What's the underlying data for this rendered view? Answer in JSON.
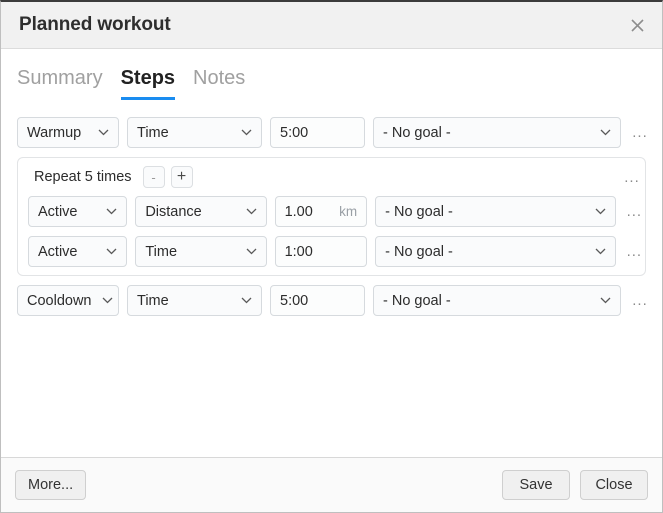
{
  "window": {
    "title": "Planned workout",
    "close_icon": "close-icon"
  },
  "tabs": [
    {
      "label": "Summary",
      "active": false
    },
    {
      "label": "Steps",
      "active": true
    },
    {
      "label": "Notes",
      "active": false
    }
  ],
  "colors": {
    "accent": "#1a8cf0",
    "titlebar_bg": "#f1f1f1",
    "control_bg": "#fafbfc",
    "control_border": "#d6dade",
    "muted_text": "#9aa0a6"
  },
  "steps": {
    "warmup": {
      "kind": "Warmup",
      "duration_type": "Time",
      "value": "5:00",
      "unit": "",
      "goal": "- No goal -",
      "menu": "..."
    },
    "repeat": {
      "label": "Repeat 5 times",
      "times": 5,
      "decrease_label": "-",
      "increase_label": "+",
      "menu": "...",
      "children": [
        {
          "kind": "Active",
          "duration_type": "Distance",
          "value": "1.00",
          "unit": "km",
          "goal": "- No goal -",
          "menu": "..."
        },
        {
          "kind": "Active",
          "duration_type": "Time",
          "value": "1:00",
          "unit": "",
          "goal": "- No goal -",
          "menu": "..."
        }
      ]
    },
    "cooldown": {
      "kind": "Cooldown",
      "duration_type": "Time",
      "value": "5:00",
      "unit": "",
      "goal": "- No goal -",
      "menu": "..."
    }
  },
  "footer": {
    "more_label": "More...",
    "save_label": "Save",
    "close_label": "Close"
  }
}
